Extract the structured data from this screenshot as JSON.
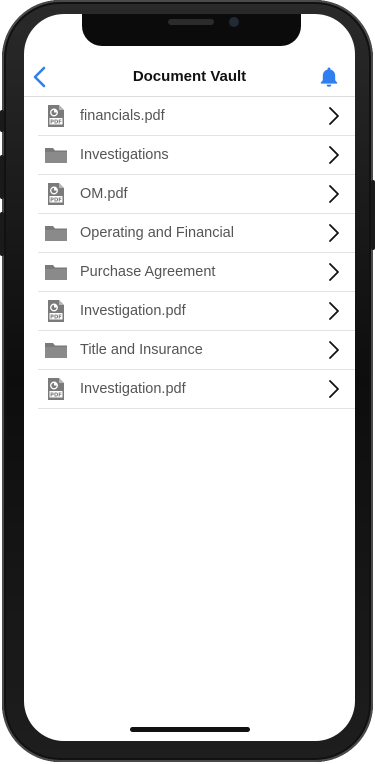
{
  "navbar": {
    "title": "Document Vault",
    "back_icon": "chevron-left-icon",
    "notification_icon": "bell-icon"
  },
  "colors": {
    "accent": "#2f7ff0",
    "icon_gray": "#7a7a7a",
    "text": "#555555"
  },
  "documents": [
    {
      "type": "pdf",
      "label": "financials.pdf"
    },
    {
      "type": "folder",
      "label": "Investigations"
    },
    {
      "type": "pdf",
      "label": "OM.pdf"
    },
    {
      "type": "folder",
      "label": "Operating and Financial"
    },
    {
      "type": "folder",
      "label": "Purchase Agreement"
    },
    {
      "type": "pdf",
      "label": "Investigation.pdf"
    },
    {
      "type": "folder",
      "label": "Title and Insurance"
    },
    {
      "type": "pdf",
      "label": "Investigation.pdf"
    }
  ]
}
